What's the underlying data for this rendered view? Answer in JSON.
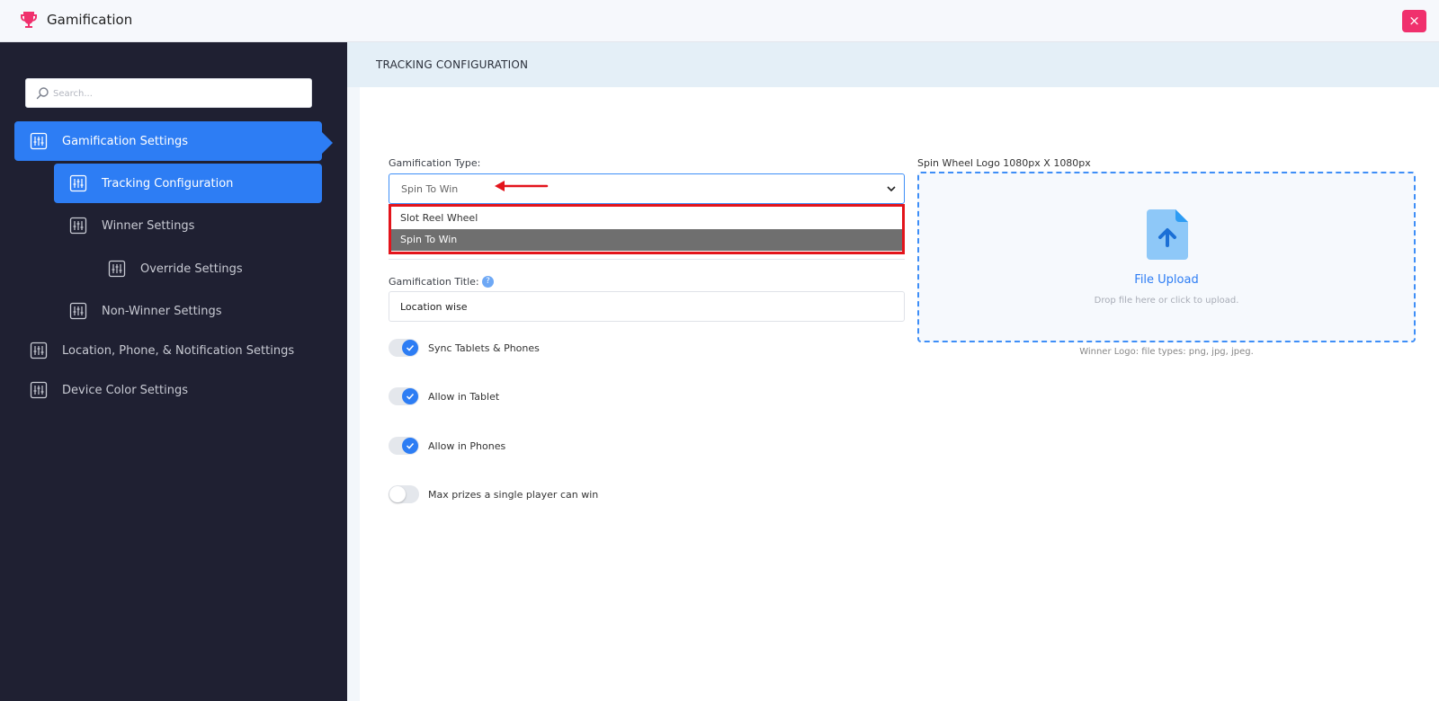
{
  "app": {
    "title": "Gamification",
    "close_label": "×"
  },
  "sidebar": {
    "search_placeholder": "Search...",
    "items": [
      {
        "label": "Gamification Settings",
        "active": true,
        "level": 0
      },
      {
        "label": "Tracking Configuration",
        "active": true,
        "level": 1
      },
      {
        "label": "Winner Settings",
        "active": false,
        "level": 1
      },
      {
        "label": "Override Settings",
        "active": false,
        "level": 2
      },
      {
        "label": "Non-Winner Settings",
        "active": false,
        "level": 1
      },
      {
        "label": "Location, Phone, & Notification Settings",
        "active": false,
        "level": 0
      },
      {
        "label": "Device Color Settings",
        "active": false,
        "level": 0
      }
    ]
  },
  "main": {
    "section_title": "TRACKING CONFIGURATION",
    "gamification_type": {
      "label": "Gamification Type:",
      "value": "Spin To Win",
      "options": [
        "Slot Reel Wheel",
        "Spin To Win"
      ],
      "highlighted_option": "Spin To Win"
    },
    "gamification_title": {
      "label": "Gamification Title:",
      "help": "?",
      "value": "Location wise"
    },
    "toggles": [
      {
        "label": "Sync Tablets & Phones",
        "on": true
      },
      {
        "label": "Allow in Tablet",
        "on": true
      },
      {
        "label": "Allow in Phones",
        "on": true
      },
      {
        "label": "Max prizes a single player can win",
        "on": false
      }
    ],
    "upload": {
      "label": "Spin Wheel Logo 1080px X 1080px",
      "title": "File Upload",
      "hint": "Drop file here or click to upload.",
      "note": "Winner Logo: file types: png, jpg, jpeg."
    }
  },
  "colors": {
    "accent": "#2d7df4",
    "sidebar_bg": "#1f2032",
    "close_button": "#f0306d",
    "annotation_red": "#e3141b"
  },
  "icons": {
    "app_logo": "trophy-icon",
    "search": "search-icon",
    "nav": "sliders-icon",
    "select": "chevron-down-icon",
    "upload": "file-upload-icon"
  }
}
